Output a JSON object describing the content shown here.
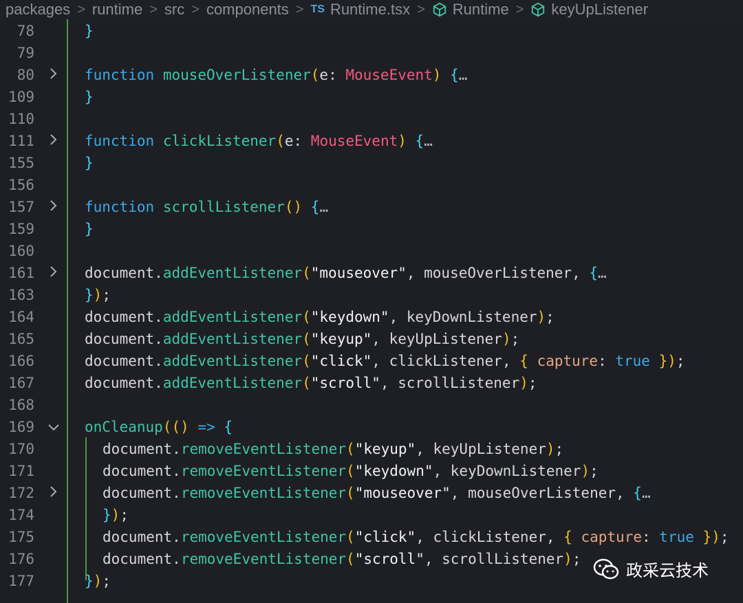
{
  "breadcrumb": {
    "items": [
      "packages",
      "runtime",
      "src",
      "components",
      "Runtime.tsx",
      "Runtime",
      "keyUpListener"
    ],
    "ts_badge": "TS"
  },
  "lines": [
    {
      "num": "78",
      "fold": "",
      "code": "}"
    },
    {
      "num": "79",
      "fold": "",
      "code": ""
    },
    {
      "num": "80",
      "fold": ">",
      "code": "function mouseOverListener(e: MouseEvent) {…"
    },
    {
      "num": "109",
      "fold": "",
      "code": "}"
    },
    {
      "num": "110",
      "fold": "",
      "code": ""
    },
    {
      "num": "111",
      "fold": ">",
      "code": "function clickListener(e: MouseEvent) {…"
    },
    {
      "num": "155",
      "fold": "",
      "code": "}"
    },
    {
      "num": "156",
      "fold": "",
      "code": ""
    },
    {
      "num": "157",
      "fold": ">",
      "code": "function scrollListener() {…"
    },
    {
      "num": "159",
      "fold": "",
      "code": "}"
    },
    {
      "num": "160",
      "fold": "",
      "code": ""
    },
    {
      "num": "161",
      "fold": ">",
      "code": "document.addEventListener(\"mouseover\", mouseOverListener, {…"
    },
    {
      "num": "163",
      "fold": "",
      "code": "});"
    },
    {
      "num": "164",
      "fold": "",
      "code": "document.addEventListener(\"keydown\", keyDownListener);"
    },
    {
      "num": "165",
      "fold": "",
      "code": "document.addEventListener(\"keyup\", keyUpListener);"
    },
    {
      "num": "166",
      "fold": "",
      "code": "document.addEventListener(\"click\", clickListener, { capture: true });"
    },
    {
      "num": "167",
      "fold": "",
      "code": "document.addEventListener(\"scroll\", scrollListener);"
    },
    {
      "num": "168",
      "fold": "",
      "code": ""
    },
    {
      "num": "169",
      "fold": "v",
      "code": "onCleanup(() => {"
    },
    {
      "num": "170",
      "fold": "",
      "code": "document.removeEventListener(\"keyup\", keyUpListener);"
    },
    {
      "num": "171",
      "fold": "",
      "code": "document.removeEventListener(\"keydown\", keyDownListener);"
    },
    {
      "num": "172",
      "fold": ">",
      "code": "document.removeEventListener(\"mouseover\", mouseOverListener, {…"
    },
    {
      "num": "174",
      "fold": "",
      "code": "});"
    },
    {
      "num": "175",
      "fold": "",
      "code": "document.removeEventListener(\"click\", clickListener, { capture: true });"
    },
    {
      "num": "176",
      "fold": "",
      "code": "document.removeEventListener(\"scroll\", scrollListener);"
    },
    {
      "num": "177",
      "fold": "",
      "code": "});"
    }
  ],
  "watermark": {
    "text": "政采云技术"
  },
  "colors": {
    "background": "#1e1f24",
    "keyword": "#3aa9e9",
    "function": "#3ec6a8",
    "type": "#f05a7e",
    "guide": "#4c9a3a"
  }
}
